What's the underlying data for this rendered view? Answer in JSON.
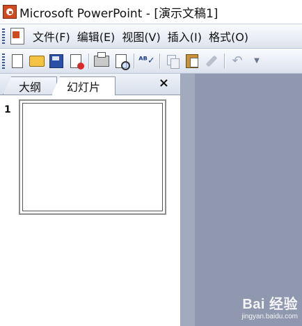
{
  "window": {
    "title": "Microsoft PowerPoint - [演示文稿1]"
  },
  "menubar": {
    "items": [
      "文件(F)",
      "编辑(E)",
      "视图(V)",
      "插入(I)",
      "格式(O)"
    ]
  },
  "toolbar": {
    "buttons": [
      "new-icon",
      "open-icon",
      "save-icon",
      "permission-icon",
      "print-icon",
      "print-preview-icon",
      "spelling-icon",
      "copy-icon",
      "paste-icon",
      "format-painter-icon",
      "undo-icon",
      "dropdown-icon"
    ]
  },
  "pane": {
    "tabs": [
      {
        "label": "大纲"
      },
      {
        "label": "幻灯片"
      }
    ],
    "close_glyph": "×",
    "slides": [
      {
        "number": "1"
      }
    ]
  },
  "watermark": {
    "main": "Bai 经验",
    "sub": "jingyan.baidu.com"
  },
  "colors": {
    "workspace": "#8f98ae",
    "accent": "#d04a1f"
  }
}
